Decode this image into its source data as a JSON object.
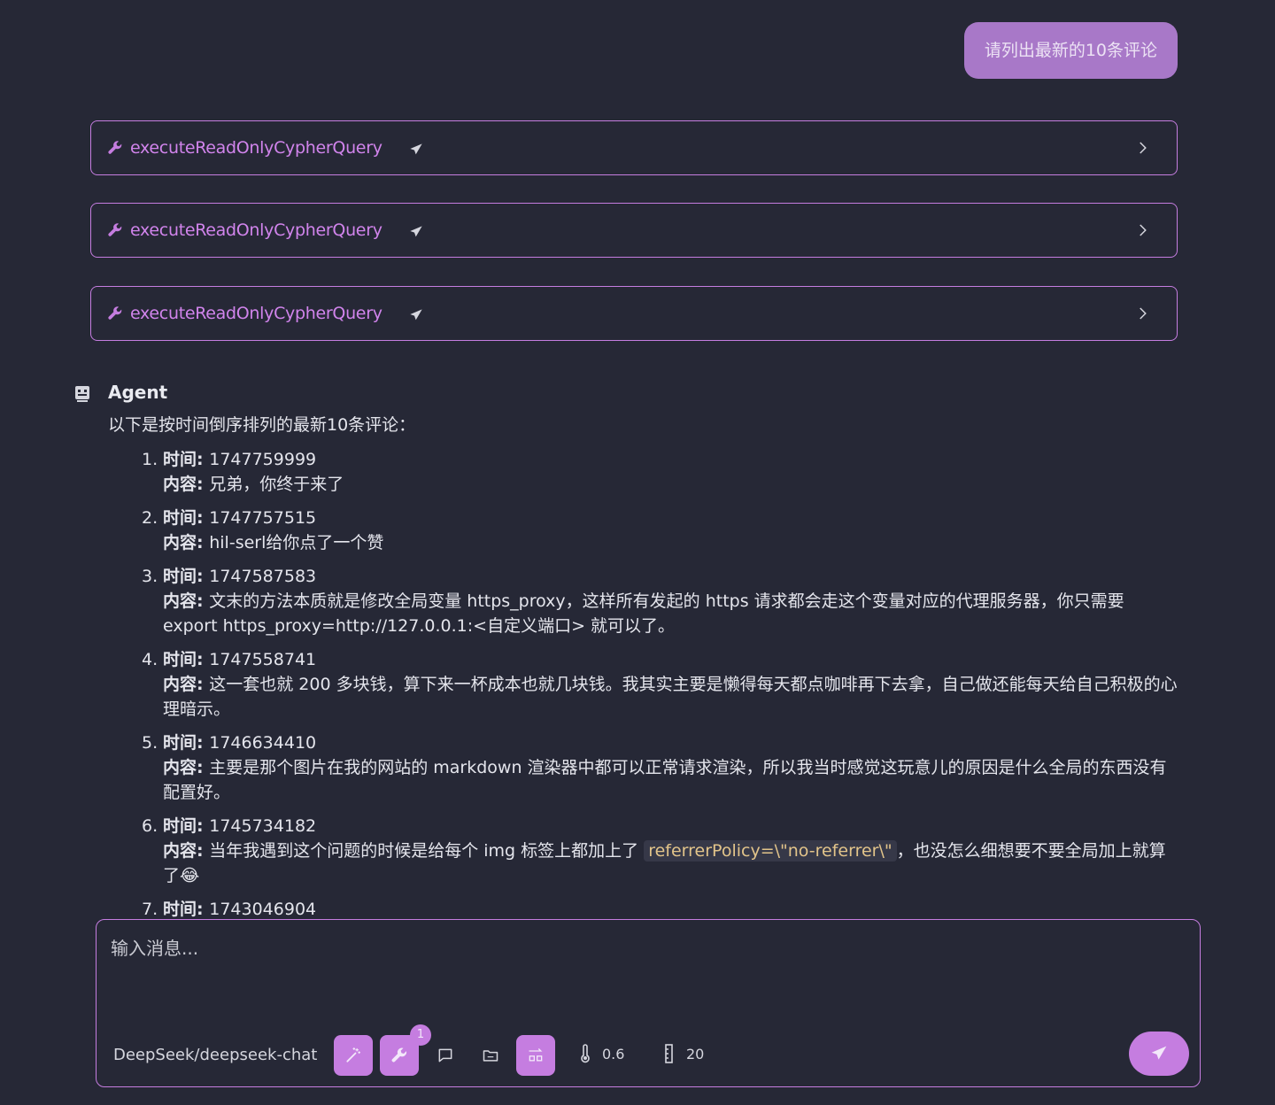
{
  "user_message": "请列出最新的10条评论",
  "tool_calls": [
    {
      "name": "executeReadOnlyCypherQuery"
    },
    {
      "name": "executeReadOnlyCypherQuery"
    },
    {
      "name": "executeReadOnlyCypherQuery"
    }
  ],
  "agent": {
    "name": "Agent",
    "intro": "以下是按时间倒序排列的最新10条评论：",
    "labels": {
      "time": "时间",
      "content": "内容"
    },
    "comments": [
      {
        "num": "1.",
        "time": "1747759999",
        "content": "兄弟，你终于来了"
      },
      {
        "num": "2.",
        "time": "1747757515",
        "content": "hil-serl给你点了一个赞"
      },
      {
        "num": "3.",
        "time": "1747587583",
        "content": "文末的方法本质就是修改全局变量 https_proxy，这样所有发起的 https 请求都会走这个变量对应的代理服务器，你只需要 export https_proxy=http://127.0.0.1:<自定义端口> 就可以了。"
      },
      {
        "num": "4.",
        "time": "1747558741",
        "content": "这一套也就 200 多块钱，算下来一杯成本也就几块钱。我其实主要是懒得每天都点咖啡再下去拿，自己做还能每天给自己积极的心理暗示。"
      },
      {
        "num": "5.",
        "time": "1746634410",
        "content": "主要是那个图片在我的网站的 markdown 渲染器中都可以正常请求渲染，所以我当时感觉这玩意儿的原因是什么全局的东西没有配置好。"
      },
      {
        "num": "6.",
        "time": "1745734182",
        "content_before": "当年我遇到这个问题的时候是给每个 img 标签上都加上了 ",
        "content_code": "referrerPolicy=\\\"no-referrer\\\"",
        "content_after": "，也没怎么细想要不要全局加上就算了😂"
      },
      {
        "num": "7.",
        "time": "1743046904",
        "content": ""
      }
    ]
  },
  "composer": {
    "placeholder": "输入消息...",
    "model": "DeepSeek/deepseek-chat",
    "tool_badge": "1",
    "temperature": "0.6",
    "max_tokens": "20"
  },
  "icons": {
    "tool": "wrench-icon",
    "send": "paper-plane-icon",
    "expand": "chevron-right-icon",
    "agent": "robot-icon",
    "wand": "magic-wand-icon",
    "chat": "chat-bubble-icon",
    "folder": "folder-icon",
    "layout": "switch-layout-icon",
    "temperature": "thermometer-icon",
    "length": "ruler-icon"
  },
  "colors": {
    "background": "#262836",
    "accent": "#c57de0",
    "user_bubble": "#a878c8",
    "inline_code": "#e2c48a"
  }
}
